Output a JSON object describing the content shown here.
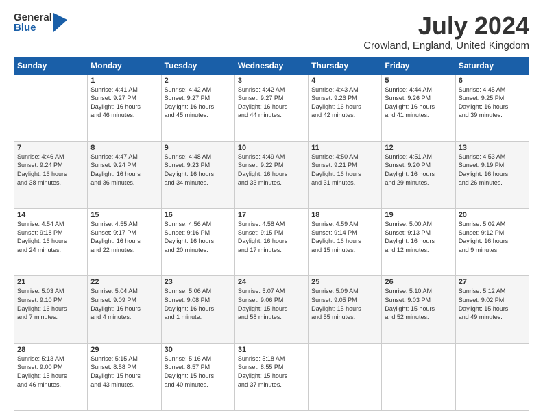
{
  "header": {
    "logo_general": "General",
    "logo_blue": "Blue",
    "title": "July 2024",
    "location": "Crowland, England, United Kingdom"
  },
  "days_of_week": [
    "Sunday",
    "Monday",
    "Tuesday",
    "Wednesday",
    "Thursday",
    "Friday",
    "Saturday"
  ],
  "weeks": [
    [
      {
        "day": "",
        "info": ""
      },
      {
        "day": "1",
        "info": "Sunrise: 4:41 AM\nSunset: 9:27 PM\nDaylight: 16 hours\nand 46 minutes."
      },
      {
        "day": "2",
        "info": "Sunrise: 4:42 AM\nSunset: 9:27 PM\nDaylight: 16 hours\nand 45 minutes."
      },
      {
        "day": "3",
        "info": "Sunrise: 4:42 AM\nSunset: 9:27 PM\nDaylight: 16 hours\nand 44 minutes."
      },
      {
        "day": "4",
        "info": "Sunrise: 4:43 AM\nSunset: 9:26 PM\nDaylight: 16 hours\nand 42 minutes."
      },
      {
        "day": "5",
        "info": "Sunrise: 4:44 AM\nSunset: 9:26 PM\nDaylight: 16 hours\nand 41 minutes."
      },
      {
        "day": "6",
        "info": "Sunrise: 4:45 AM\nSunset: 9:25 PM\nDaylight: 16 hours\nand 39 minutes."
      }
    ],
    [
      {
        "day": "7",
        "info": "Sunrise: 4:46 AM\nSunset: 9:24 PM\nDaylight: 16 hours\nand 38 minutes."
      },
      {
        "day": "8",
        "info": "Sunrise: 4:47 AM\nSunset: 9:24 PM\nDaylight: 16 hours\nand 36 minutes."
      },
      {
        "day": "9",
        "info": "Sunrise: 4:48 AM\nSunset: 9:23 PM\nDaylight: 16 hours\nand 34 minutes."
      },
      {
        "day": "10",
        "info": "Sunrise: 4:49 AM\nSunset: 9:22 PM\nDaylight: 16 hours\nand 33 minutes."
      },
      {
        "day": "11",
        "info": "Sunrise: 4:50 AM\nSunset: 9:21 PM\nDaylight: 16 hours\nand 31 minutes."
      },
      {
        "day": "12",
        "info": "Sunrise: 4:51 AM\nSunset: 9:20 PM\nDaylight: 16 hours\nand 29 minutes."
      },
      {
        "day": "13",
        "info": "Sunrise: 4:53 AM\nSunset: 9:19 PM\nDaylight: 16 hours\nand 26 minutes."
      }
    ],
    [
      {
        "day": "14",
        "info": "Sunrise: 4:54 AM\nSunset: 9:18 PM\nDaylight: 16 hours\nand 24 minutes."
      },
      {
        "day": "15",
        "info": "Sunrise: 4:55 AM\nSunset: 9:17 PM\nDaylight: 16 hours\nand 22 minutes."
      },
      {
        "day": "16",
        "info": "Sunrise: 4:56 AM\nSunset: 9:16 PM\nDaylight: 16 hours\nand 20 minutes."
      },
      {
        "day": "17",
        "info": "Sunrise: 4:58 AM\nSunset: 9:15 PM\nDaylight: 16 hours\nand 17 minutes."
      },
      {
        "day": "18",
        "info": "Sunrise: 4:59 AM\nSunset: 9:14 PM\nDaylight: 16 hours\nand 15 minutes."
      },
      {
        "day": "19",
        "info": "Sunrise: 5:00 AM\nSunset: 9:13 PM\nDaylight: 16 hours\nand 12 minutes."
      },
      {
        "day": "20",
        "info": "Sunrise: 5:02 AM\nSunset: 9:12 PM\nDaylight: 16 hours\nand 9 minutes."
      }
    ],
    [
      {
        "day": "21",
        "info": "Sunrise: 5:03 AM\nSunset: 9:10 PM\nDaylight: 16 hours\nand 7 minutes."
      },
      {
        "day": "22",
        "info": "Sunrise: 5:04 AM\nSunset: 9:09 PM\nDaylight: 16 hours\nand 4 minutes."
      },
      {
        "day": "23",
        "info": "Sunrise: 5:06 AM\nSunset: 9:08 PM\nDaylight: 16 hours\nand 1 minute."
      },
      {
        "day": "24",
        "info": "Sunrise: 5:07 AM\nSunset: 9:06 PM\nDaylight: 15 hours\nand 58 minutes."
      },
      {
        "day": "25",
        "info": "Sunrise: 5:09 AM\nSunset: 9:05 PM\nDaylight: 15 hours\nand 55 minutes."
      },
      {
        "day": "26",
        "info": "Sunrise: 5:10 AM\nSunset: 9:03 PM\nDaylight: 15 hours\nand 52 minutes."
      },
      {
        "day": "27",
        "info": "Sunrise: 5:12 AM\nSunset: 9:02 PM\nDaylight: 15 hours\nand 49 minutes."
      }
    ],
    [
      {
        "day": "28",
        "info": "Sunrise: 5:13 AM\nSunset: 9:00 PM\nDaylight: 15 hours\nand 46 minutes."
      },
      {
        "day": "29",
        "info": "Sunrise: 5:15 AM\nSunset: 8:58 PM\nDaylight: 15 hours\nand 43 minutes."
      },
      {
        "day": "30",
        "info": "Sunrise: 5:16 AM\nSunset: 8:57 PM\nDaylight: 15 hours\nand 40 minutes."
      },
      {
        "day": "31",
        "info": "Sunrise: 5:18 AM\nSunset: 8:55 PM\nDaylight: 15 hours\nand 37 minutes."
      },
      {
        "day": "",
        "info": ""
      },
      {
        "day": "",
        "info": ""
      },
      {
        "day": "",
        "info": ""
      }
    ]
  ]
}
